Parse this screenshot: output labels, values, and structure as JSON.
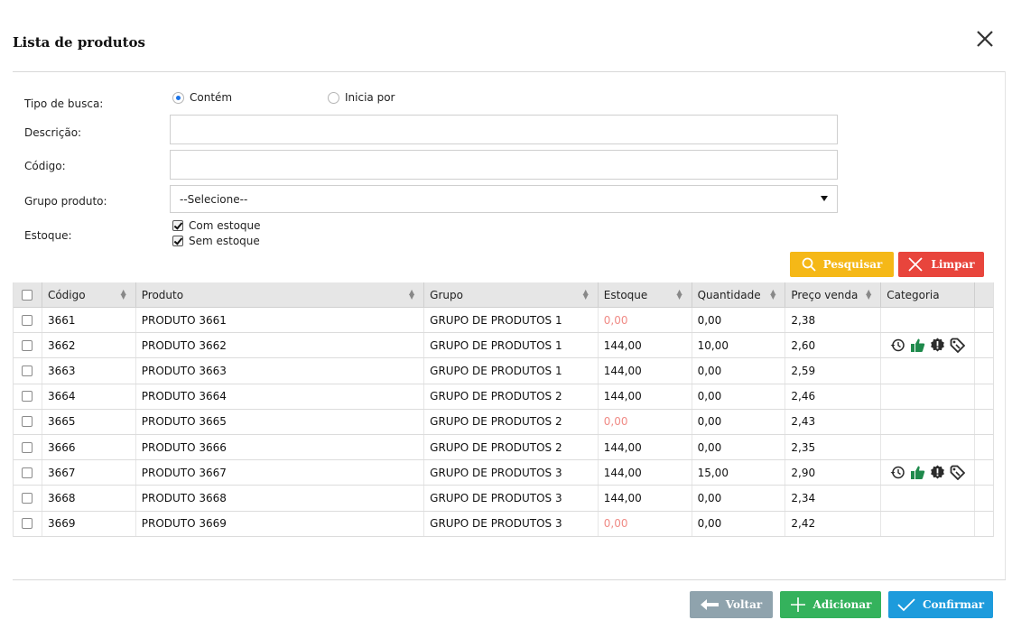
{
  "dialog": {
    "title": "Lista de produtos"
  },
  "filters": {
    "tipo_busca_label": "Tipo de busca:",
    "opt_contem": "Contém",
    "opt_inicia": "Inicia por",
    "descricao_label": "Descrição:",
    "descricao_value": "",
    "codigo_label": "Código:",
    "codigo_value": "",
    "grupo_label": "Grupo produto:",
    "grupo_selected": "--Selecione--",
    "estoque_label": "Estoque:",
    "com_estoque": "Com estoque",
    "sem_estoque": "Sem estoque"
  },
  "actions": {
    "pesquisar": "Pesquisar",
    "limpar": "Limpar"
  },
  "table": {
    "headers": [
      "Código",
      "Produto",
      "Grupo",
      "Estoque",
      "Quantidade",
      "Preço venda",
      "Categoria"
    ],
    "rows": [
      {
        "codigo": "3661",
        "produto": "PRODUTO 3661",
        "grupo": "GRUPO DE PRODUTOS 1",
        "estoque": "0,00",
        "quantidade": "0,00",
        "preco": "2,38",
        "zero": true,
        "icons": false
      },
      {
        "codigo": "3662",
        "produto": "PRODUTO 3662",
        "grupo": "GRUPO DE PRODUTOS 1",
        "estoque": "144,00",
        "quantidade": "10,00",
        "preco": "2,60",
        "zero": false,
        "icons": true
      },
      {
        "codigo": "3663",
        "produto": "PRODUTO 3663",
        "grupo": "GRUPO DE PRODUTOS 1",
        "estoque": "144,00",
        "quantidade": "0,00",
        "preco": "2,59",
        "zero": false,
        "icons": false
      },
      {
        "codigo": "3664",
        "produto": "PRODUTO 3664",
        "grupo": "GRUPO DE PRODUTOS 2",
        "estoque": "144,00",
        "quantidade": "0,00",
        "preco": "2,46",
        "zero": false,
        "icons": false
      },
      {
        "codigo": "3665",
        "produto": "PRODUTO 3665",
        "grupo": "GRUPO DE PRODUTOS 2",
        "estoque": "0,00",
        "quantidade": "0,00",
        "preco": "2,43",
        "zero": true,
        "icons": false
      },
      {
        "codigo": "3666",
        "produto": "PRODUTO 3666",
        "grupo": "GRUPO DE PRODUTOS 2",
        "estoque": "144,00",
        "quantidade": "0,00",
        "preco": "2,35",
        "zero": false,
        "icons": false
      },
      {
        "codigo": "3667",
        "produto": "PRODUTO 3667",
        "grupo": "GRUPO DE PRODUTOS 3",
        "estoque": "144,00",
        "quantidade": "15,00",
        "preco": "2,90",
        "zero": false,
        "icons": true
      },
      {
        "codigo": "3668",
        "produto": "PRODUTO 3668",
        "grupo": "GRUPO DE PRODUTOS 3",
        "estoque": "144,00",
        "quantidade": "0,00",
        "preco": "2,34",
        "zero": false,
        "icons": false
      },
      {
        "codigo": "3669",
        "produto": "PRODUTO 3669",
        "grupo": "GRUPO DE PRODUTOS 3",
        "estoque": "0,00",
        "quantidade": "0,00",
        "preco": "2,42",
        "zero": true,
        "icons": false
      }
    ],
    "category_icons": [
      "history-icon",
      "thumbs-up-icon",
      "badge-alert-icon",
      "tag-icon"
    ]
  },
  "footer": {
    "voltar": "Voltar",
    "adicionar": "Adicionar",
    "confirmar": "Confirmar"
  },
  "colors": {
    "search": "#f5b817",
    "clear": "#e8453c",
    "back": "#8fa3ad",
    "add": "#34b25c",
    "confirm": "#1d9bdc",
    "zero_stock": "#f08b86",
    "icon_green": "#1f8a4c",
    "icon_dark": "#2b2b2b"
  }
}
